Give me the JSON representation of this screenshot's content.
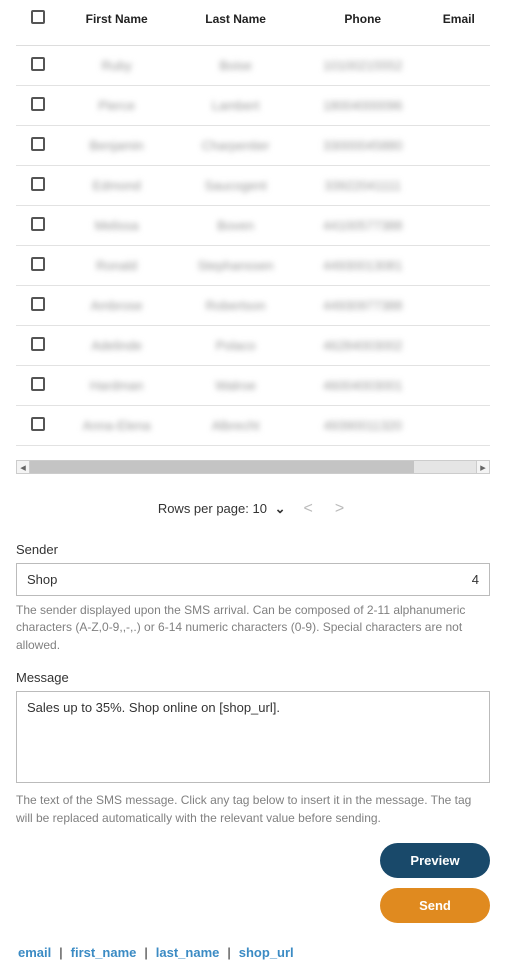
{
  "table": {
    "headers": {
      "first_name": "First Name",
      "last_name": "Last Name",
      "phone": "Phone",
      "email": "Email"
    },
    "rows": [
      {
        "first_name": "Ruby",
        "last_name": "Boise",
        "phone": "10100215552"
      },
      {
        "first_name": "Pierce",
        "last_name": "Lambert",
        "phone": "18004000096"
      },
      {
        "first_name": "Benjamin",
        "last_name": "Charpentier",
        "phone": "33000045880"
      },
      {
        "first_name": "Edmond",
        "last_name": "Saucogent",
        "phone": "33922041111"
      },
      {
        "first_name": "Melissa",
        "last_name": "Boven",
        "phone": "44100577388"
      },
      {
        "first_name": "Ronald",
        "last_name": "Stephanssen",
        "phone": "44930013081"
      },
      {
        "first_name": "Ambrose",
        "last_name": "Robertson",
        "phone": "44930977388"
      },
      {
        "first_name": "Adelinde",
        "last_name": "Polaco",
        "phone": "46284003002"
      },
      {
        "first_name": "Hardman",
        "last_name": "Walroe",
        "phone": "46004003001"
      },
      {
        "first_name": "Anna-Elena",
        "last_name": "Albrecht",
        "phone": "49390011320"
      }
    ]
  },
  "pager": {
    "rows_per_page_label": "Rows per page:",
    "rows_per_page_value": "10"
  },
  "sender": {
    "label": "Sender",
    "value": "Shop",
    "counter": "4",
    "help": "The sender displayed upon the SMS arrival. Can be composed of 2-11 alphanumeric characters (A-Z,0-9,,-,.) or 6-14 numeric characters (0-9). Special characters are not allowed."
  },
  "message": {
    "label": "Message",
    "value": "Sales up to 35%. Shop online on [shop_url].",
    "help": "The text of the SMS message. Click any tag below to insert it in the message. The tag will be replaced automatically with the relevant value before sending."
  },
  "actions": {
    "preview": "Preview",
    "send": "Send"
  },
  "tags": {
    "items": [
      "email",
      "first_name",
      "last_name",
      "shop_url"
    ]
  },
  "colors": {
    "link": "#3b8bc4",
    "preview_btn": "#19496a",
    "send_btn": "#e08a1f"
  }
}
